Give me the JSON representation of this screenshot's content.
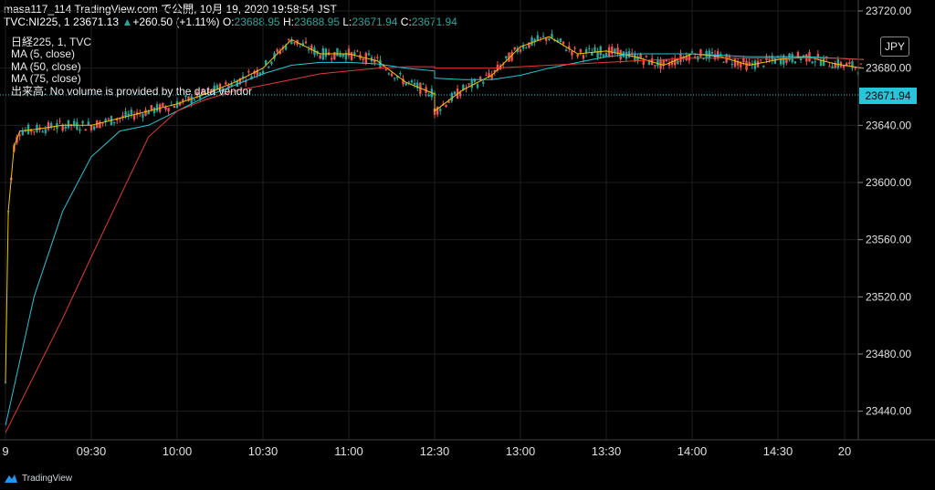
{
  "header": {
    "line1": "masa117_114 TradingView.com で公開, 10月 19, 2020 19:58:54 JST",
    "symbol": "TVC:NI225, 1",
    "price": "23671.13",
    "change": "+260.50 (+1.11%)",
    "o_label": "O:",
    "o_value": "23688.95",
    "h_label": "H:",
    "h_value": "23688.95",
    "l_label": "L:",
    "l_value": "23671.94",
    "c_label": "C:",
    "c_value": "23671.94"
  },
  "legend": {
    "title": "日経225, 1, TVC",
    "ma5": "MA (5, close)",
    "ma50": "MA (50, close)",
    "ma75": "MA (75, close)",
    "volume": "出来高: No volume is provided by the data vendor"
  },
  "currency": "JPY",
  "last_price_label": "23671.94",
  "footer": {
    "brand": "TradingView",
    "logo_icon": "tradingview-logo-icon"
  },
  "colors": {
    "up": "#26a69a",
    "down": "#ef5350",
    "ma5": "#f3c300",
    "ma50": "#26c6da",
    "ma75": "#e53935",
    "price_tag": "#26c6da"
  },
  "chart_data": {
    "type": "candlestick",
    "ylim": [
      23420,
      23720
    ],
    "y_ticks": [
      "23440.00",
      "23480.00",
      "23520.00",
      "23560.00",
      "23600.00",
      "23640.00",
      "23680.00",
      "23720.00"
    ],
    "x_ticks": [
      "9",
      "09:30",
      "10:00",
      "10:30",
      "11:00",
      "12:30",
      "13:00",
      "13:30",
      "14:00",
      "14:30",
      "20"
    ],
    "grid": true,
    "series": [
      {
        "name": "MA (5, close)",
        "x": [
          "09:00",
          "09:01",
          "09:03",
          "09:05",
          "09:10",
          "09:20",
          "09:30",
          "09:40",
          "09:50",
          "10:00",
          "10:10",
          "10:20",
          "10:30",
          "10:40",
          "10:50",
          "11:00",
          "11:10",
          "11:20",
          "11:30",
          "12:30",
          "12:40",
          "12:50",
          "13:00",
          "13:10",
          "13:20",
          "13:30",
          "13:40",
          "13:50",
          "14:00",
          "14:10",
          "14:20",
          "14:30",
          "14:40",
          "14:50",
          "15:00"
        ],
        "values": [
          23460,
          23580,
          23625,
          23636,
          23637,
          23640,
          23640,
          23645,
          23650,
          23655,
          23662,
          23670,
          23680,
          23700,
          23690,
          23690,
          23685,
          23670,
          23662,
          23650,
          23665,
          23675,
          23695,
          23702,
          23690,
          23692,
          23688,
          23682,
          23690,
          23688,
          23682,
          23686,
          23688,
          23683,
          23680
        ]
      },
      {
        "name": "MA (50, close)",
        "x": [
          "09:00",
          "09:10",
          "09:20",
          "09:30",
          "09:40",
          "09:50",
          "10:00",
          "10:10",
          "10:20",
          "10:30",
          "10:40",
          "10:50",
          "11:00",
          "11:10",
          "11:20",
          "11:30",
          "12:30",
          "12:40",
          "12:50",
          "13:00",
          "13:10",
          "13:20",
          "13:30",
          "13:40",
          "13:50",
          "14:00",
          "14:10",
          "14:20",
          "14:30",
          "14:40",
          "14:50",
          "15:00"
        ],
        "values": [
          23430,
          23520,
          23580,
          23618,
          23636,
          23640,
          23650,
          23660,
          23668,
          23676,
          23682,
          23684,
          23684,
          23683,
          23680,
          23678,
          23673,
          23672,
          23672,
          23675,
          23680,
          23684,
          23688,
          23690,
          23690,
          23690,
          23689,
          23688,
          23688,
          23688,
          23687,
          23686
        ]
      },
      {
        "name": "MA (75, close)",
        "x": [
          "09:00",
          "09:10",
          "09:20",
          "09:30",
          "09:40",
          "09:50",
          "10:00",
          "10:10",
          "10:20",
          "10:30",
          "10:40",
          "10:50",
          "11:00",
          "11:10",
          "11:20",
          "11:30",
          "12:30",
          "12:40",
          "12:50",
          "13:00",
          "13:10",
          "13:20",
          "13:30",
          "13:40",
          "13:50",
          "14:00",
          "14:10",
          "14:20",
          "14:30",
          "14:40",
          "14:50",
          "15:00"
        ],
        "values": [
          23425,
          23465,
          23505,
          23548,
          23590,
          23632,
          23650,
          23658,
          23664,
          23668,
          23672,
          23676,
          23678,
          23680,
          23681,
          23681,
          23680,
          23680,
          23680,
          23681,
          23682,
          23683,
          23684,
          23685,
          23686,
          23687,
          23687,
          23687,
          23687,
          23687,
          23687,
          23686
        ]
      }
    ]
  }
}
